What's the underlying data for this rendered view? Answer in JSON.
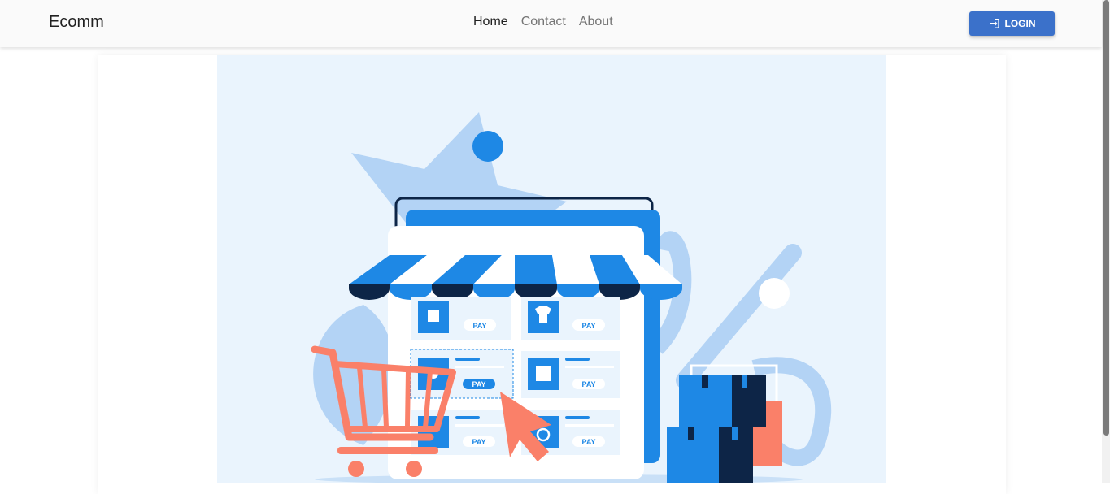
{
  "navbar": {
    "brand": "Ecomm",
    "links": [
      {
        "label": "Home",
        "active": true
      },
      {
        "label": "Contact",
        "active": false
      },
      {
        "label": "About",
        "active": false
      }
    ],
    "login_label": "LOGIN",
    "login_icon": "sign-in-icon"
  },
  "hero": {
    "pay_labels": [
      "PAY",
      "PAY",
      "PAY",
      "PAY",
      "PAY",
      "PAY"
    ],
    "product_icons": [
      "gift-icon",
      "shirt-icon",
      "watch-icon",
      "bag-icon",
      "item-icon",
      "ring-icon"
    ]
  },
  "colors": {
    "primary_button": "#3b71ca",
    "illustration_blue": "#1e88e5",
    "illustration_navy": "#0d2547",
    "illustration_coral": "#fa8069",
    "hero_background": "#eaf4fd"
  }
}
